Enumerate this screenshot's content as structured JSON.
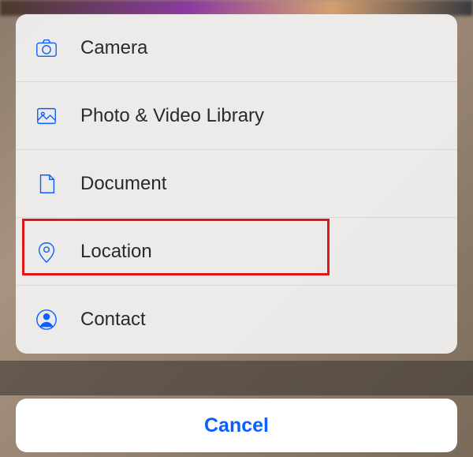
{
  "action_sheet": {
    "items": [
      {
        "label": "Camera",
        "icon": "camera-icon"
      },
      {
        "label": "Photo & Video Library",
        "icon": "photo-icon"
      },
      {
        "label": "Document",
        "icon": "document-icon"
      },
      {
        "label": "Location",
        "icon": "location-icon",
        "highlighted": true
      },
      {
        "label": "Contact",
        "icon": "contact-icon"
      }
    ],
    "cancel_label": "Cancel"
  },
  "colors": {
    "accent": "#0a60ff",
    "highlight_border": "#e01818"
  }
}
